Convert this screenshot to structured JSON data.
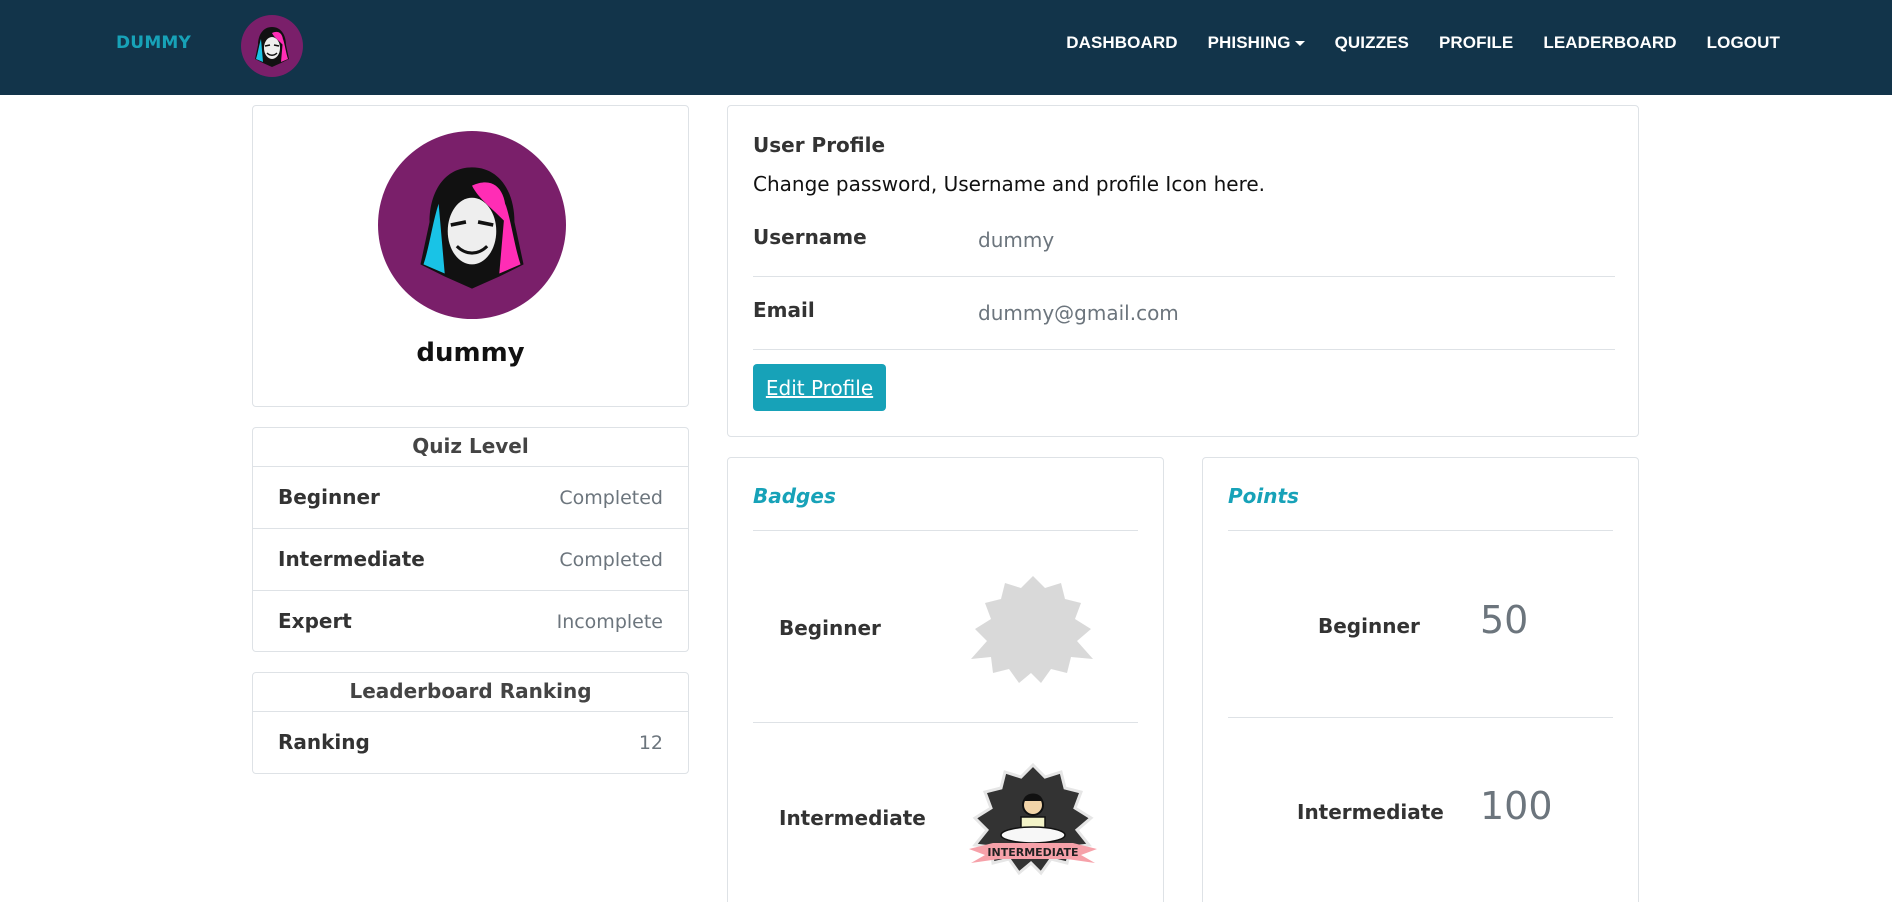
{
  "nav": {
    "brand": "DUMMY",
    "items": [
      "DASHBOARD",
      "PHISHING",
      "QUIZZES",
      "PROFILE",
      "LEADERBOARD",
      "LOGOUT"
    ]
  },
  "profile": {
    "name": "dummy"
  },
  "quiz_level": {
    "title": "Quiz Level",
    "rows": [
      {
        "label": "Beginner",
        "value": "Completed"
      },
      {
        "label": "Intermediate",
        "value": "Completed"
      },
      {
        "label": "Expert",
        "value": "Incomplete"
      }
    ]
  },
  "leaderboard": {
    "title": "Leaderboard Ranking",
    "label": "Ranking",
    "value": "12"
  },
  "user_profile": {
    "title": "User Profile",
    "description": "Change password, Username and profile Icon here.",
    "username_label": "Username",
    "username_value": "dummy",
    "email_label": "Email",
    "email_value": "dummy@gmail.com",
    "edit_button": "Edit Profile"
  },
  "badges": {
    "title": "Badges",
    "items": [
      {
        "label": "Beginner",
        "badge_text": ""
      },
      {
        "label": "Intermediate",
        "badge_text": "INTERMEDIATE"
      }
    ]
  },
  "points": {
    "title": "Points",
    "items": [
      {
        "label": "Beginner",
        "value": "50"
      },
      {
        "label": "Intermediate",
        "value": "100"
      }
    ]
  },
  "colors": {
    "navbar": "#12344a",
    "accent": "#17a2b8",
    "avatar_bg": "#7a1f6a"
  }
}
